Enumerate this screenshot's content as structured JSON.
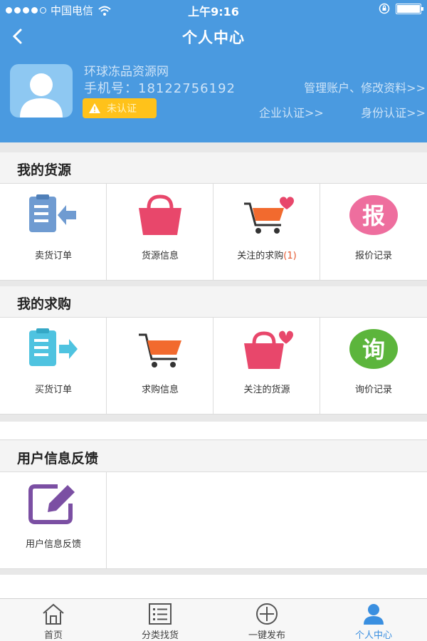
{
  "status_bar": {
    "carrier": "中国电信",
    "time": "上午9:16"
  },
  "nav": {
    "title": "个人中心"
  },
  "profile": {
    "name": "环球冻品资源网",
    "phone": "手机号：18122756192",
    "verify_badge": "未认证",
    "manage_link": "管理账户、修改资料>>",
    "enterprise_link": "企业认证>>",
    "identity_link": "身份认证>>"
  },
  "supply": {
    "title": "我的货源",
    "items": [
      {
        "label": "卖货订单",
        "icon": "sell-order-icon"
      },
      {
        "label": "货源信息",
        "icon": "bag-icon"
      },
      {
        "label": "关注的求购",
        "count": "(1)",
        "icon": "cart-heart-icon"
      },
      {
        "label": "报价记录",
        "icon": "quote-icon"
      }
    ]
  },
  "purchase": {
    "title": "我的求购",
    "items": [
      {
        "label": "买货订单",
        "icon": "buy-order-icon"
      },
      {
        "label": "求购信息",
        "icon": "cart-icon"
      },
      {
        "label": "关注的货源",
        "icon": "bag-heart-icon"
      },
      {
        "label": "询价记录",
        "icon": "inquiry-icon"
      }
    ]
  },
  "feedback": {
    "title": "用户信息反馈",
    "items": [
      {
        "label": "用户信息反馈",
        "icon": "edit-icon"
      }
    ]
  },
  "tabbar": {
    "items": [
      {
        "label": "首页",
        "icon": "home-icon"
      },
      {
        "label": "分类找货",
        "icon": "list-icon"
      },
      {
        "label": "一键发布",
        "icon": "plus-circle-icon"
      },
      {
        "label": "个人中心",
        "icon": "user-icon",
        "active": true
      }
    ]
  },
  "colors": {
    "header": "#4a9ae0",
    "badge": "#ffc21a",
    "active_tab": "#3a8fe0"
  }
}
